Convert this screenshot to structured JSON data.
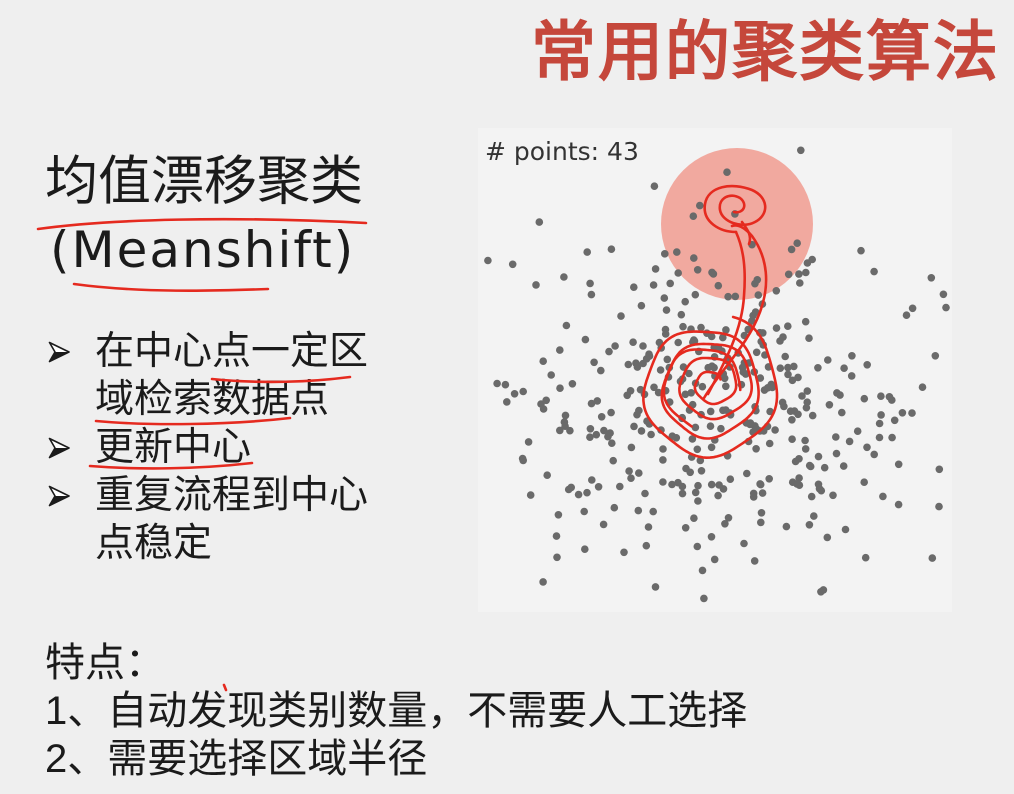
{
  "slide": {
    "title": "常用的聚类算法",
    "heading": "均值漂移聚类",
    "heading_en": "(Meanshift)",
    "bullet_icon": "arrowhead-right-icon",
    "bullets": [
      {
        "lines": [
          "在中心点一定区",
          "域检索数据点"
        ]
      },
      {
        "lines": [
          "更新中心"
        ]
      },
      {
        "lines": [
          "重复流程到中心",
          "点稳定"
        ]
      }
    ],
    "features_label": "特点：",
    "features": [
      "1、自动发现类别数量，不需要人工选择",
      "2、需要选择区域半径"
    ]
  },
  "figure": {
    "points_label": "# points: 43"
  },
  "colors": {
    "background": "#efefef",
    "text": "#1b1b1b",
    "title": "#c5473b",
    "ink": "#e52a1f",
    "point": "#6a6a6a",
    "window": "#f1a398",
    "figure_background": "#f3f3f3"
  }
}
